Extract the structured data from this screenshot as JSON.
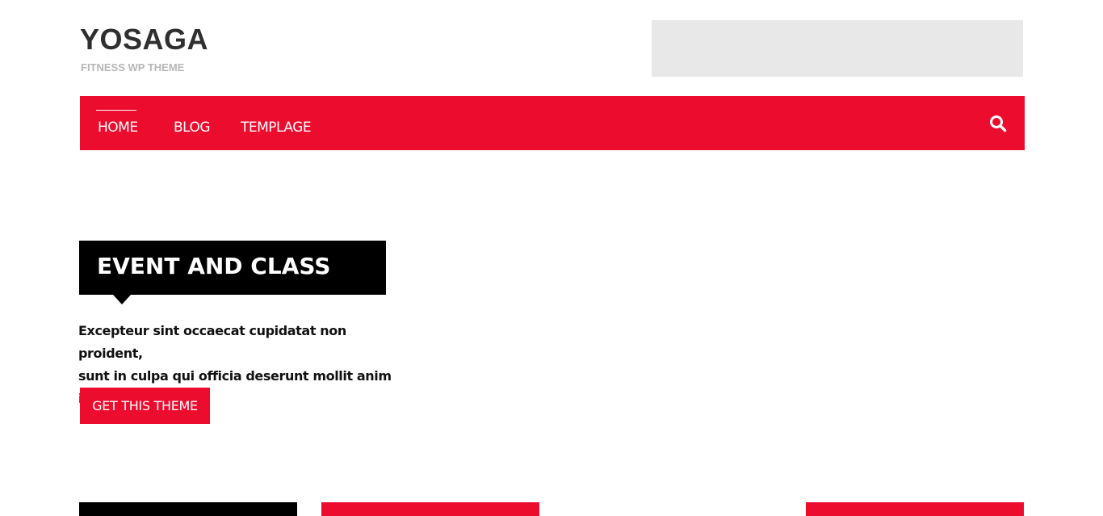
{
  "header": {
    "site_title": "YOSAGA",
    "tagline": "FITNESS WP THEME"
  },
  "nav": {
    "items": [
      {
        "label": "HOME",
        "active": true
      },
      {
        "label": "BLOG",
        "active": false
      },
      {
        "label": "TEMPLAGE",
        "active": false
      }
    ],
    "search_icon": "search-icon"
  },
  "hero": {
    "title": "EVENT AND CLASS",
    "description_line1": "Excepteur sint occaecat cupidatat non proident,",
    "description_line2": "sunt in culpa qui officia deserunt mollit anim id",
    "button_label": "GET THIS THEME"
  },
  "colors": {
    "accent": "#ec0c2e",
    "dark": "#000000",
    "banner": "#e8e8e8"
  }
}
